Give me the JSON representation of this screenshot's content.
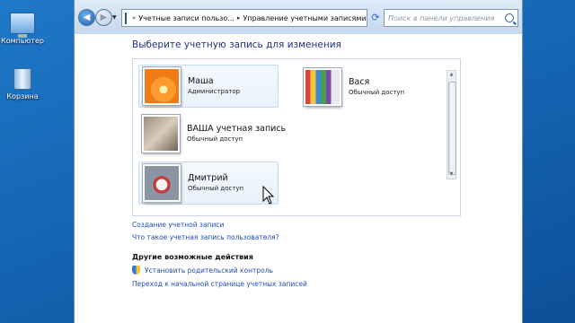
{
  "desktop": {
    "icons": [
      {
        "label": "Компьютер",
        "icon": "computer-icon"
      },
      {
        "label": "Корзина",
        "icon": "recycle-bin-icon"
      }
    ]
  },
  "window": {
    "address": {
      "segment1": "Учетные записи пользо...",
      "segment2": "Управление учетными записями"
    },
    "search_placeholder": "Поиск в панели управления",
    "heading": "Выберите учетную запись для изменения",
    "accounts": [
      {
        "name": "Маша",
        "role": "Администратор",
        "picture": "flower"
      },
      {
        "name": "Вася",
        "role": "Обычный доступ",
        "picture": "pencils"
      },
      {
        "name": "ВАША учетная запись",
        "role": "Обычный доступ",
        "picture": "cat"
      },
      {
        "name": "Дмитрий",
        "role": "Обычный доступ",
        "picture": "origami"
      }
    ],
    "links": {
      "create_account": "Создание учетной записи",
      "what_is_account": "Что такое учетная запись пользователя?"
    },
    "other_actions": {
      "heading": "Другие возможные действия",
      "parental_control": "Установить родительский контроль",
      "go_home": "Переход к начальной странице учетных записей"
    }
  },
  "colors": {
    "link": "#1f4db6",
    "heading": "#1e3287",
    "desktop_bg": "#1566b4"
  }
}
